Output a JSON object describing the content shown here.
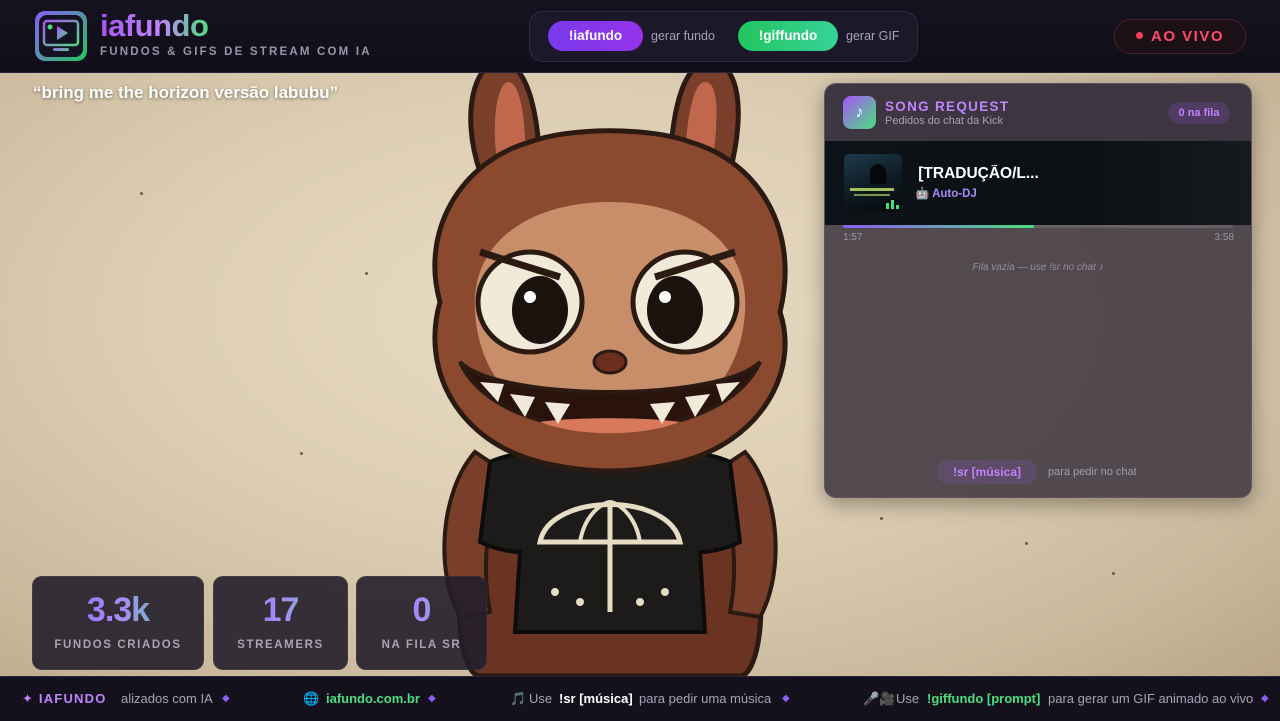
{
  "header": {
    "brand_name": "iafundo",
    "brand_tagline": "FUNDOS & GIFS DE STREAM COM IA",
    "commands": [
      {
        "label": "!iafundo",
        "description": "gerar fundo",
        "color": "#9333ea"
      },
      {
        "label": "!giffundo",
        "description": "gerar GIF",
        "color": "#22c55e"
      }
    ],
    "live_label": "AO VIVO"
  },
  "scene": {
    "prompt": "“bring me the horizon versão labubu”"
  },
  "song_request": {
    "title": "SONG REQUEST",
    "subtitle": "Pedidos do chat da Kick",
    "queue_badge": "0 na fila",
    "now_playing": {
      "song": "nd [TRADUÇÃO/L...",
      "source": "🤖 Auto-DJ",
      "elapsed": "1:57",
      "duration": "3:58",
      "progress": 0.49
    },
    "empty_message": "Fila vazia — use !sr no chat ♪",
    "command": "!sr [música]",
    "command_hint": "para pedir no chat"
  },
  "stats": [
    {
      "value": "3.3k",
      "label": "FUNDOS CRIADOS"
    },
    {
      "value": "17",
      "label": "STREAMERS"
    },
    {
      "value": "0",
      "label": "NA FILA SR"
    }
  ],
  "ticker": {
    "brand": "✦ IAFUNDO",
    "item1": "alizados com IA",
    "site_icon": "🌐",
    "site": "iafundo.com.br",
    "item3_icon": "🎵",
    "item3_use": "Use",
    "item3_cmd": "!sr [música]",
    "item3_text": "para pedir uma música",
    "item4_icon": "🎤🎥",
    "item4_use": "Use",
    "item4_cmd": "!giffundo [prompt]",
    "item4_text": "para gerar um GIF animado ao vivo",
    "separator": "◆"
  },
  "colors": {
    "accent_purple": "#a855f7",
    "accent_green": "#4ade80",
    "live_red": "#ff4d6d"
  }
}
